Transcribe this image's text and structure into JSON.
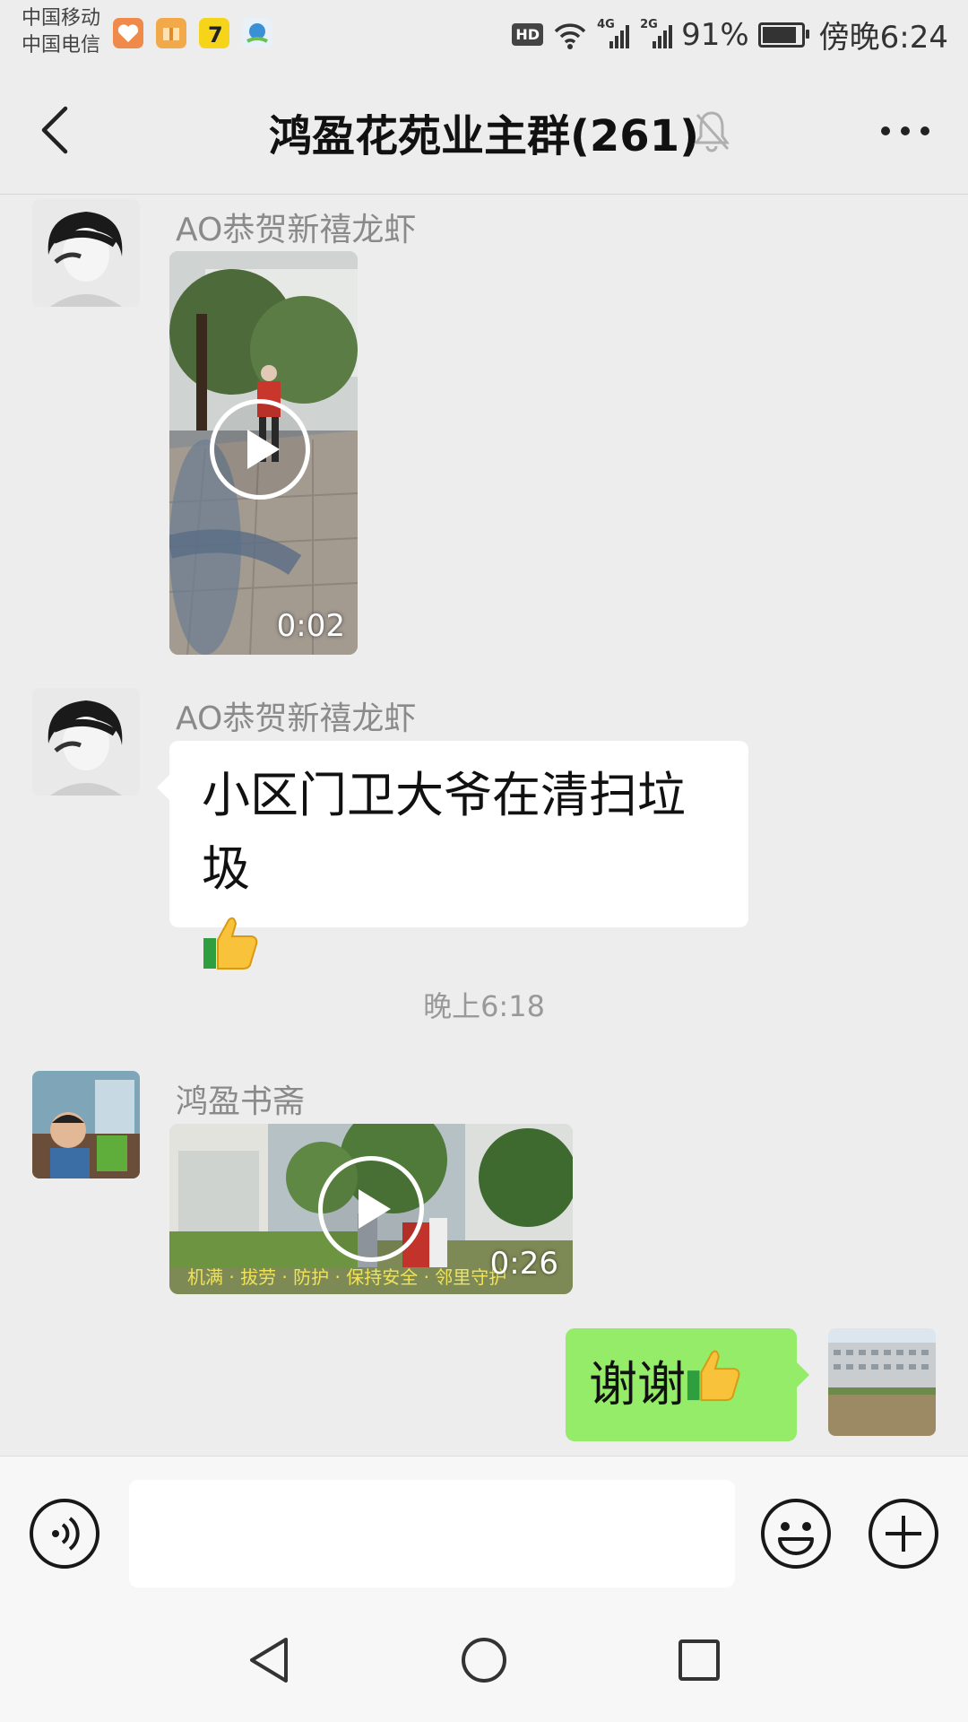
{
  "status_bar": {
    "carrier_1": "中国移动",
    "carrier_2": "中国电信",
    "hd": "HD",
    "net_1": "4G",
    "net_2": "2G",
    "battery": "91%",
    "battery_level": 0.91,
    "time": "傍晚6:24"
  },
  "header": {
    "title": "鸿盈花苑业主群(261)",
    "back_icon": "chevron-left-icon",
    "mute_icon": "bell-off-icon",
    "more_icon": "more-horizontal-icon"
  },
  "messages": [
    {
      "type": "video",
      "sender": "AO恭贺新禧龙虾",
      "duration": "0:02"
    },
    {
      "type": "text",
      "sender": "AO恭贺新禧龙虾",
      "text": "小区门卫大爷在清扫垃圾",
      "emoji": "👍"
    },
    {
      "type": "timestamp",
      "text": "晚上6:18"
    },
    {
      "type": "video",
      "sender": "鸿盈书斋",
      "duration": "0:26",
      "caption": "机满 · 拔劳 · 防护 · 保持安全 · 邻里守护"
    },
    {
      "type": "text",
      "own": true,
      "text": "谢谢",
      "emoji": "👍"
    }
  ],
  "input_bar": {
    "voice_icon": "voice-icon",
    "emoji_icon": "emoji-icon",
    "plus_icon": "plus-circle-icon",
    "text_value": ""
  },
  "colors": {
    "background": "#ededed",
    "own_bubble": "#95ec69",
    "other_bubble": "#ffffff"
  }
}
